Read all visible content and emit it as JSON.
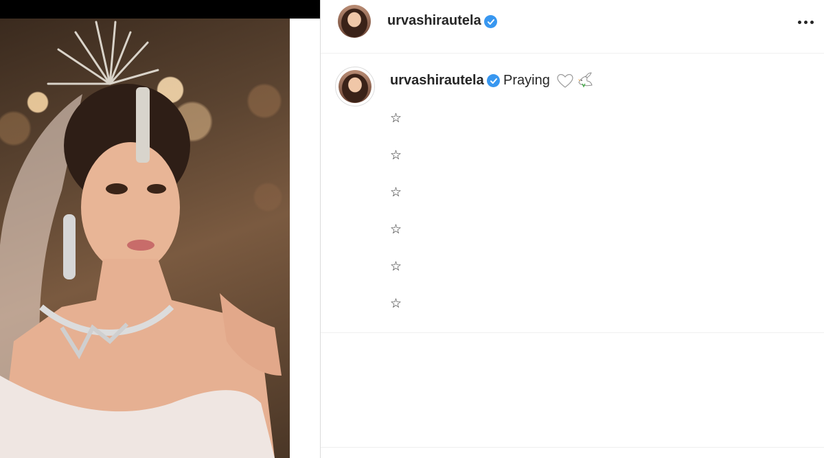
{
  "post": {
    "username": "urvashirautela",
    "verified": true,
    "more_icon": "more-options-icon"
  },
  "caption": {
    "username": "urvashirautela",
    "text": "Praying",
    "emoji": [
      "white-heart-icon",
      "dove-icon"
    ],
    "star_lines": [
      "☆",
      "☆",
      "☆",
      "☆",
      "☆",
      "☆"
    ]
  },
  "colors": {
    "verified_badge": "#3897f0",
    "text": "#262626",
    "divider": "#efefef"
  }
}
